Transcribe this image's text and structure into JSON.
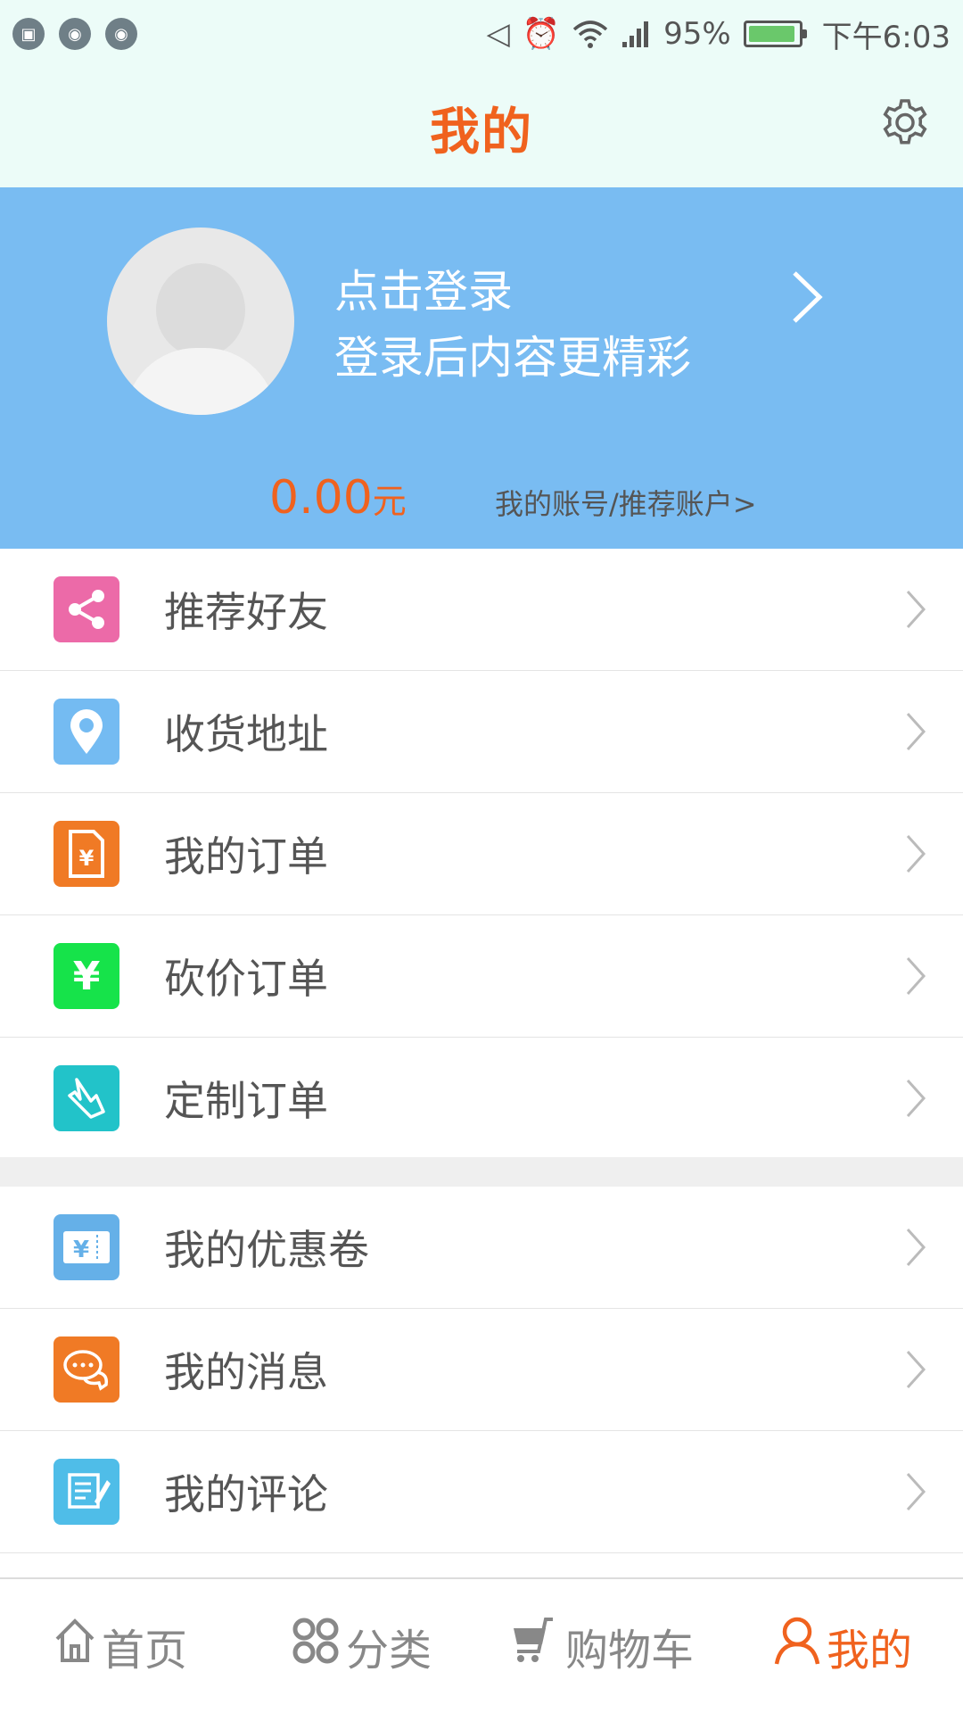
{
  "status_bar": {
    "notification_icons": [
      "image-icon",
      "android-icon",
      "android-icon"
    ],
    "battery_percent": "95%",
    "battery_level": 0.95,
    "time": "下午6:03"
  },
  "header": {
    "title": "我的"
  },
  "profile": {
    "login_prompt": "点击登录",
    "login_subtitle": "登录后内容更精彩",
    "balance_amount": "0.00",
    "balance_unit": "元",
    "account_link": "我的账号/推荐账户>"
  },
  "menu_group_1": [
    {
      "label": "推荐好友",
      "icon": "share-icon",
      "color": "#ec6aa8"
    },
    {
      "label": "收货地址",
      "icon": "location-pin-icon",
      "color": "#74bbf2"
    },
    {
      "label": "我的订单",
      "icon": "order-document-icon",
      "color": "#f07a25"
    },
    {
      "label": "砍价订单",
      "icon": "yen-icon",
      "color": "#16e34a"
    },
    {
      "label": "定制订单",
      "icon": "hand-pointer-icon",
      "color": "#22c3c9"
    }
  ],
  "menu_group_2": [
    {
      "label": "我的优惠卷",
      "icon": "coupon-icon",
      "color": "#65b0e8"
    },
    {
      "label": "我的消息",
      "icon": "chat-bubbles-icon",
      "color": "#f07a25"
    },
    {
      "label": "我的评论",
      "icon": "comment-scroll-icon",
      "color": "#4fbde8"
    }
  ],
  "bottom_nav": [
    {
      "label": "首页",
      "icon": "home-icon",
      "active": false
    },
    {
      "label": "分类",
      "icon": "category-icon",
      "active": false
    },
    {
      "label": "购物车",
      "icon": "cart-icon",
      "active": false
    },
    {
      "label": "我的",
      "icon": "user-icon",
      "active": true
    }
  ],
  "colors": {
    "accent": "#f0621e",
    "profile_bg": "#79bcf2",
    "header_bg": "#ecfcf8"
  }
}
